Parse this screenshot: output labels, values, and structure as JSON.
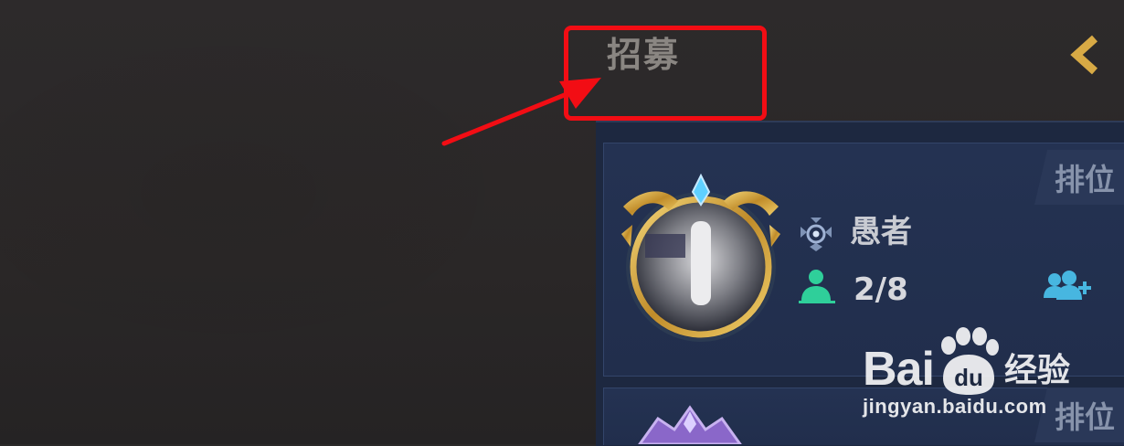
{
  "header": {
    "title": "招募",
    "back_icon": "chevron-left-icon"
  },
  "annotation": {
    "box_color": "#f20d14",
    "arrow_color": "#f20d14"
  },
  "recruit_list": {
    "cards": [
      {
        "mode_tag": "排位",
        "player_name": "愚者",
        "team_count": "2/8",
        "rank_icon": "rank-emblem-icon",
        "members_icon": "people-icon",
        "join_icon": "add-group-icon"
      },
      {
        "mode_tag": "排位"
      }
    ]
  },
  "watermark": {
    "logo_left": "Bai",
    "logo_right": "经验",
    "paw_text": "du",
    "url": "jingyan.baidu.com"
  },
  "colors": {
    "background": "#2b2929",
    "panel": "#1d2840",
    "accent_green": "#2fcf9a",
    "accent_cyan": "#47b6e0",
    "gold": "#d8aa45"
  }
}
